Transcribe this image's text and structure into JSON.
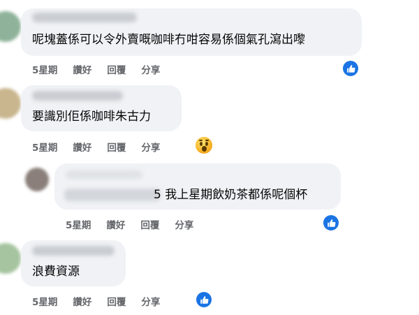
{
  "comments": [
    {
      "text": "呢塊蓋係可以令外賣嘅咖啡冇咁容易係個氣孔瀉出嚟",
      "time": "5星期",
      "like": "讚好",
      "reply": "回覆",
      "share": "分享",
      "reaction": "like-icon"
    },
    {
      "text": "要識別佢係咖啡朱古力",
      "time": "5星期",
      "like": "讚好",
      "reply": "回覆",
      "share": "分享",
      "reaction": "wow-icon"
    },
    {
      "text_visible": "5 我上星期飲奶茶都係呢個杯",
      "time": "5星期",
      "like": "讚好",
      "reply": "回覆",
      "share": "分享",
      "reaction": "like-icon"
    },
    {
      "text": "浪費資源",
      "time": "5星期",
      "like": "讚好",
      "reply": "回覆",
      "share": "分享",
      "reaction": "like-icon"
    }
  ],
  "colors": {
    "bubble": "#f0f2f5",
    "meta": "#65676b",
    "like_blue": "#1b74e4",
    "text": "#050505"
  }
}
